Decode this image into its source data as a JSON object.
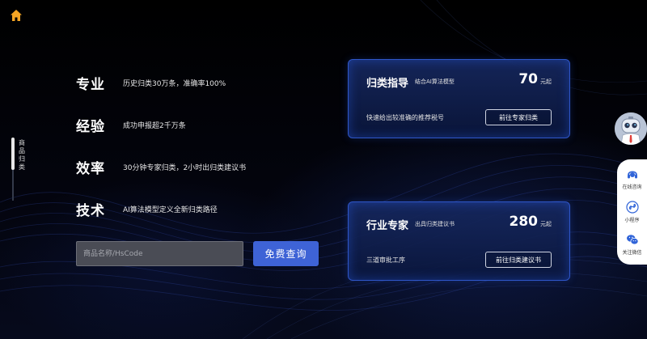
{
  "colors": {
    "accent_blue": "#3e63d6",
    "card_border": "#2f56c8",
    "home_orange": "#f5a524",
    "background": "#02030a"
  },
  "nav": {
    "home_icon": "home-icon",
    "vertical_label": "商品归类"
  },
  "features": [
    {
      "title": "专业",
      "desc": "历史归类30万条，准确率100%"
    },
    {
      "title": "经验",
      "desc": "成功申报超2千万条"
    },
    {
      "title": "效率",
      "desc": "30分钟专家归类，2小时出归类建议书"
    },
    {
      "title": "技术",
      "desc": "AI算法模型定义全新归类路径"
    }
  ],
  "search": {
    "placeholder": "商品名称/HsCode",
    "button_label": "免费查询"
  },
  "cards": [
    {
      "title": "归类指导",
      "subtitle": "结合AI算法模型",
      "price": "70",
      "price_unit": "元起",
      "desc": "快速给出较准确的推荐税号",
      "button_label": "前往专家归类"
    },
    {
      "title": "行业专家",
      "subtitle": "出具归类建议书",
      "price": "280",
      "price_unit": "元起",
      "desc": "三道审批工序",
      "button_label": "前往归类建议书"
    }
  ],
  "side_panel": {
    "items": [
      {
        "icon": "headset-icon",
        "label": "在线咨询"
      },
      {
        "icon": "mini-program-icon",
        "label": "小程序"
      },
      {
        "icon": "wechat-icon",
        "label": "关注微信"
      }
    ]
  }
}
